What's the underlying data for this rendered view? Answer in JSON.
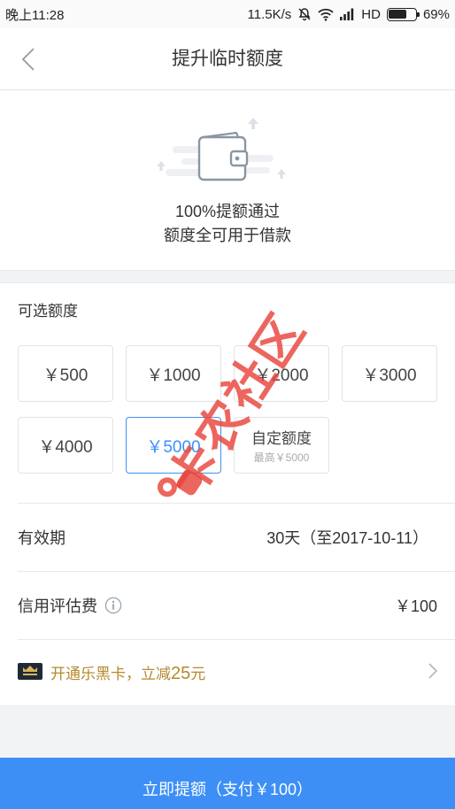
{
  "status_bar": {
    "time": "晚上11:28",
    "speed": "11.5K/s",
    "network": "HD",
    "battery": "69%"
  },
  "header": {
    "title": "提升临时额度",
    "back_icon": "chevron-left-icon"
  },
  "hero": {
    "illustration": "wallet-icon",
    "line1": "100%提额通过",
    "line2": "额度全可用于借款"
  },
  "amount_section": {
    "title": "可选额度",
    "options": [
      {
        "label": "￥500",
        "selected": false
      },
      {
        "label": "￥1000",
        "selected": false
      },
      {
        "label": "￥2000",
        "selected": false
      },
      {
        "label": "￥3000",
        "selected": false
      },
      {
        "label": "￥4000",
        "selected": false
      },
      {
        "label": "￥5000",
        "selected": true
      }
    ],
    "custom": {
      "label": "自定额度",
      "max": "最高￥5000"
    }
  },
  "validity": {
    "label": "有效期",
    "value": "30天（至2017-10-11）"
  },
  "fee": {
    "label": "信用评估费",
    "value": "￥100",
    "icon": "info-icon"
  },
  "promo": {
    "icon": "black-card-icon",
    "prefix": "开通乐黑卡，立减",
    "amount": "25",
    "suffix": "元"
  },
  "submit": {
    "label": "立即提额（支付￥100）"
  },
  "watermark": {
    "text": "卡农社区"
  },
  "colors": {
    "accent": "#3d8ff6",
    "promo": "#b58a2c",
    "watermark": "#e8453c"
  }
}
